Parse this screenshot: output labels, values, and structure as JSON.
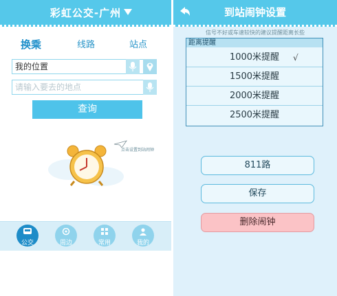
{
  "left": {
    "title": "彩虹公交-广州",
    "tabs": [
      "换乘",
      "线路",
      "站点"
    ],
    "origin_value": "我的位置",
    "destination_placeholder": "请输入要去的地点",
    "query_label": "查询",
    "alarm_caption": "点击设置到站闹钟",
    "nav": [
      {
        "label": "公交",
        "icon": "bus-icon"
      },
      {
        "label": "周边",
        "icon": "nearby-icon"
      },
      {
        "label": "常用",
        "icon": "grid-icon"
      },
      {
        "label": "我的",
        "icon": "user-icon"
      }
    ],
    "colors": {
      "header": "#55c8ea",
      "accent": "#1d8cc8"
    }
  },
  "right": {
    "title": "到站闹钟设置",
    "hint": "信号不好或车速较快的建议提醒距离长些",
    "list_header": "距离提醒",
    "options": [
      "1000米提醒",
      "1500米提醒",
      "2000米提醒",
      "2500米提醒"
    ],
    "selected_check": "√",
    "route_label": "811路",
    "save_label": "保存",
    "delete_label": "删除闹钟",
    "colors": {
      "panel_bg": "#dff1fb",
      "danger": "#fbc3c6"
    }
  }
}
